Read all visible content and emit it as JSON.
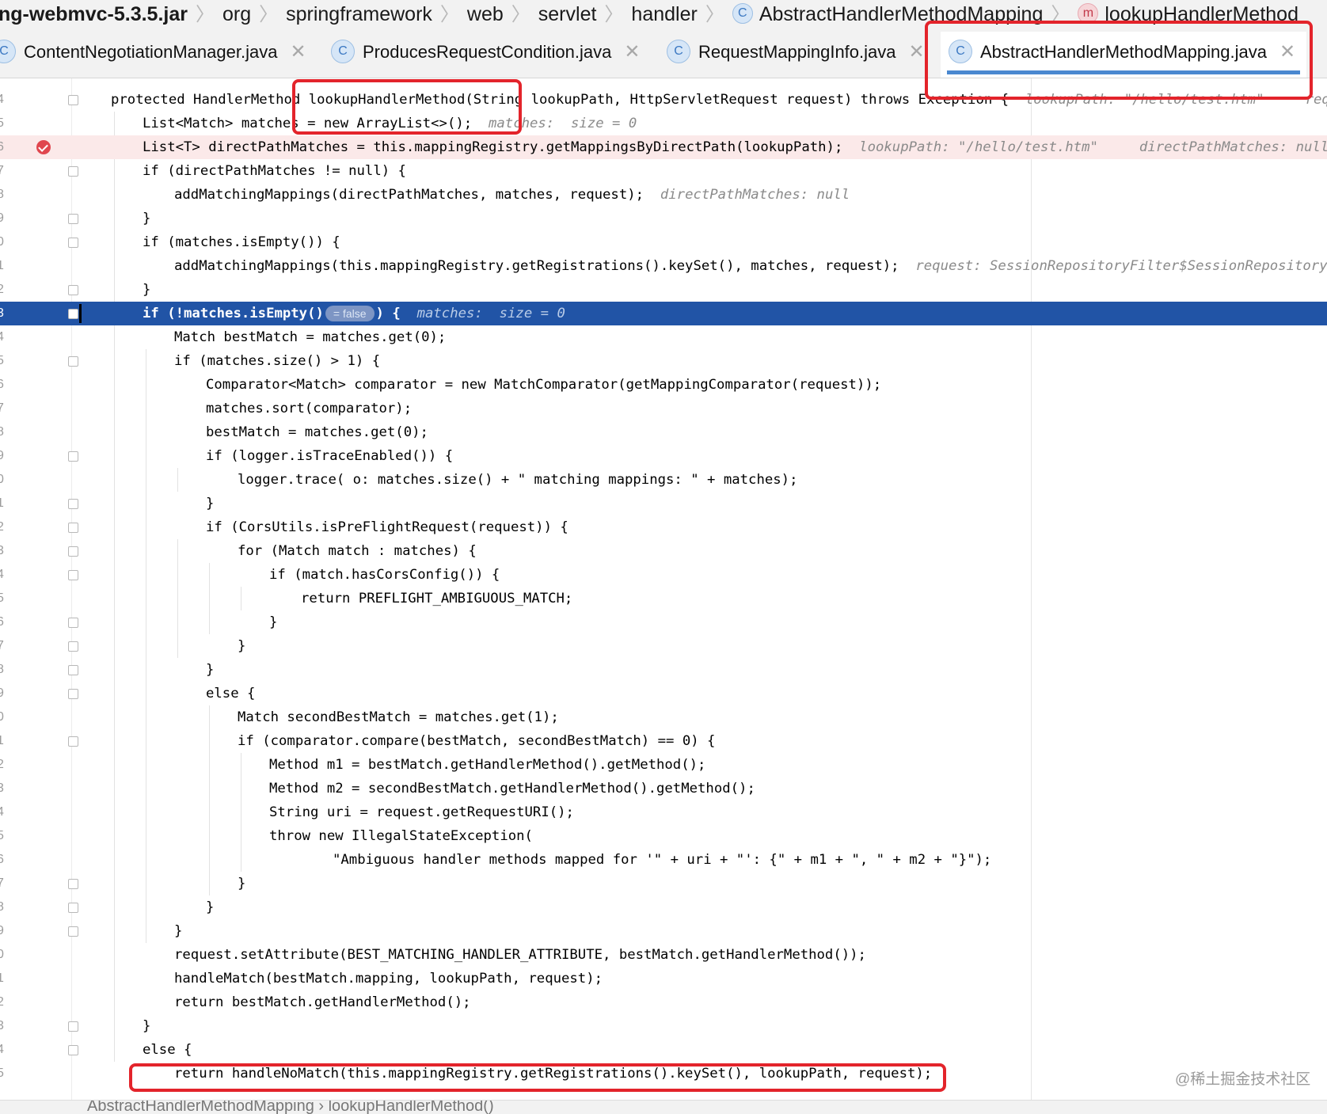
{
  "breadcrumb": {
    "items": [
      "ng-webmvc-5.3.5.jar",
      "org",
      "springframework",
      "web",
      "servlet",
      "handler",
      "AbstractHandlerMethodMapping",
      "lookupHandlerMethod"
    ],
    "class_icon_letter": "C",
    "method_icon_letter": "m",
    "separator": "〉"
  },
  "tabs": [
    {
      "label": "ContentNegotiationManager.java",
      "icon": "C",
      "close": "✕"
    },
    {
      "label": "ProducesRequestCondition.java",
      "icon": "C",
      "close": "✕"
    },
    {
      "label": "RequestMappingInfo.java",
      "icon": "C",
      "close": "✕"
    },
    {
      "label": "AbstractHandlerMethodMapping.java",
      "icon": "C",
      "close": "✕"
    }
  ],
  "gutter": {
    "line_numbers": [
      "4",
      "5",
      "6",
      "7",
      "8",
      "9",
      "0",
      "1",
      "2",
      "3",
      "4",
      "5",
      "6",
      "7",
      "8",
      "9",
      "0",
      "1",
      "2",
      "3",
      "4",
      "5",
      "6",
      "7",
      "8",
      "9",
      "0",
      "1",
      "2",
      "3",
      "4",
      "5",
      "6",
      "7",
      "8",
      "9",
      "0",
      "1",
      "2",
      "3",
      "4",
      "5"
    ]
  },
  "code": {
    "lines": [
      {
        "indent": 0,
        "text": "protected HandlerMethod lookupHandlerMethod(String lookupPath, HttpServletRequest request) throws Exception {",
        "hint": "  lookupPath: \"/hello/test.htm\"     request:"
      },
      {
        "indent": 1,
        "text": "List<Match> matches = new ArrayList<>();",
        "hint": "  matches:  size = 0"
      },
      {
        "indent": 1,
        "text": "List<T> directPathMatches = this.mappingRegistry.getMappingsByDirectPath(lookupPath);",
        "hint": "  lookupPath: \"/hello/test.htm\"     directPathMatches: null"
      },
      {
        "indent": 1,
        "text": "if (directPathMatches != null) {",
        "hint": ""
      },
      {
        "indent": 2,
        "text": "addMatchingMappings(directPathMatches, matches, request);",
        "hint": "  directPathMatches: null"
      },
      {
        "indent": 1,
        "text": "}",
        "hint": ""
      },
      {
        "indent": 1,
        "text": "if (matches.isEmpty()) {",
        "hint": ""
      },
      {
        "indent": 2,
        "text": "addMatchingMappings(this.mappingRegistry.getRegistrations().keySet(), matches, request);",
        "hint": "  request: SessionRepositoryFilter$SessionRepositoryReque"
      },
      {
        "indent": 1,
        "text": "}",
        "hint": ""
      },
      {
        "indent": 1,
        "text": "if (!matches.isEmpty()",
        "chip": "= false",
        "text_after": ") {",
        "hint": "  matches:  size = 0"
      },
      {
        "indent": 2,
        "text": "Match bestMatch = matches.get(0);",
        "hint": ""
      },
      {
        "indent": 2,
        "text": "if (matches.size() > 1) {",
        "hint": ""
      },
      {
        "indent": 3,
        "text": "Comparator<Match> comparator = new MatchComparator(getMappingComparator(request));",
        "hint": ""
      },
      {
        "indent": 3,
        "text": "matches.sort(comparator);",
        "hint": ""
      },
      {
        "indent": 3,
        "text": "bestMatch = matches.get(0);",
        "hint": ""
      },
      {
        "indent": 3,
        "text": "if (logger.isTraceEnabled()) {",
        "hint": ""
      },
      {
        "indent": 4,
        "text": "logger.trace( o: matches.size() + \" matching mappings: \" + matches);",
        "hint": ""
      },
      {
        "indent": 3,
        "text": "}",
        "hint": ""
      },
      {
        "indent": 3,
        "text": "if (CorsUtils.isPreFlightRequest(request)) {",
        "hint": ""
      },
      {
        "indent": 4,
        "text": "for (Match match : matches) {",
        "hint": ""
      },
      {
        "indent": 5,
        "text": "if (match.hasCorsConfig()) {",
        "hint": ""
      },
      {
        "indent": 6,
        "text": "return PREFLIGHT_AMBIGUOUS_MATCH;",
        "hint": ""
      },
      {
        "indent": 5,
        "text": "}",
        "hint": ""
      },
      {
        "indent": 4,
        "text": "}",
        "hint": ""
      },
      {
        "indent": 3,
        "text": "}",
        "hint": ""
      },
      {
        "indent": 3,
        "text": "else {",
        "hint": ""
      },
      {
        "indent": 4,
        "text": "Match secondBestMatch = matches.get(1);",
        "hint": ""
      },
      {
        "indent": 4,
        "text": "if (comparator.compare(bestMatch, secondBestMatch) == 0) {",
        "hint": ""
      },
      {
        "indent": 5,
        "text": "Method m1 = bestMatch.getHandlerMethod().getMethod();",
        "hint": ""
      },
      {
        "indent": 5,
        "text": "Method m2 = secondBestMatch.getHandlerMethod().getMethod();",
        "hint": ""
      },
      {
        "indent": 5,
        "text": "String uri = request.getRequestURI();",
        "hint": ""
      },
      {
        "indent": 5,
        "text": "throw new IllegalStateException(",
        "hint": ""
      },
      {
        "indent": 7,
        "text": "\"Ambiguous handler methods mapped for '\" + uri + \"': {\" + m1 + \", \" + m2 + \"}\");",
        "hint": ""
      },
      {
        "indent": 4,
        "text": "}",
        "hint": ""
      },
      {
        "indent": 3,
        "text": "}",
        "hint": ""
      },
      {
        "indent": 2,
        "text": "}",
        "hint": ""
      },
      {
        "indent": 2,
        "text": "request.setAttribute(BEST_MATCHING_HANDLER_ATTRIBUTE, bestMatch.getHandlerMethod());",
        "hint": ""
      },
      {
        "indent": 2,
        "text": "handleMatch(bestMatch.mapping, lookupPath, request);",
        "hint": ""
      },
      {
        "indent": 2,
        "text": "return bestMatch.getHandlerMethod();",
        "hint": ""
      },
      {
        "indent": 1,
        "text": "}",
        "hint": ""
      },
      {
        "indent": 1,
        "text": "else {",
        "hint": ""
      },
      {
        "indent": 2,
        "text": "return handleNoMatch(this.mappingRegistry.getRegistrations().keySet(), lookupPath, request);",
        "hint": ""
      }
    ]
  },
  "bottom_breadcrumb": "AbstractHandlerMethodMapping  ›  lookupHandlerMethod()",
  "watermark": "@稀土掘金技术社区",
  "colors": {
    "current_line": "#2154a6",
    "breakpoint_line": "#fbe9e9",
    "breakpoint": "#e0464e",
    "annotation_box": "#e3242b",
    "active_tab_underline": "#4a88d0"
  }
}
